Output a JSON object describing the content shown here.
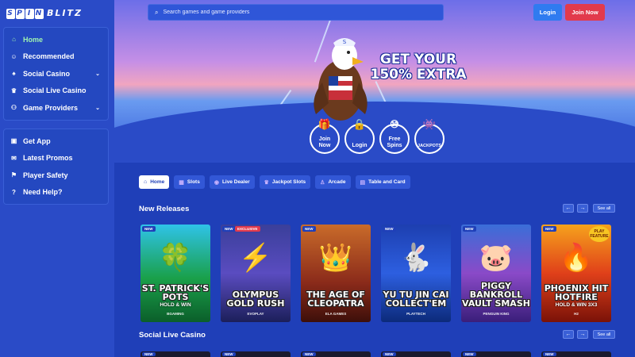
{
  "brand": {
    "logo_spin": [
      "S",
      "P",
      "I",
      "N"
    ],
    "logo_blitz": "BLITZ"
  },
  "sidebar": {
    "group1": [
      {
        "label": "Home",
        "icon": "home-icon",
        "glyph": "⌂"
      },
      {
        "label": "Recommended",
        "icon": "smile-icon",
        "glyph": "☺"
      },
      {
        "label": "Social Casino",
        "icon": "spade-icon",
        "glyph": "♠"
      },
      {
        "label": "Social Live Casino",
        "icon": "crown-icon",
        "glyph": "♛"
      },
      {
        "label": "Game Providers",
        "icon": "person-icon",
        "glyph": "⚇"
      }
    ],
    "group2": [
      {
        "label": "Get App",
        "icon": "app-icon",
        "glyph": "▣"
      },
      {
        "label": "Latest Promos",
        "icon": "gift-icon",
        "glyph": "✉"
      },
      {
        "label": "Player Safety",
        "icon": "shield-icon",
        "glyph": "⚑"
      },
      {
        "label": "Need Help?",
        "icon": "help-icon",
        "glyph": "?"
      }
    ],
    "chevron": "⌄"
  },
  "search": {
    "placeholder": "Search games and game providers"
  },
  "header": {
    "login_label": "Login",
    "join_label": "Join Now"
  },
  "hero": {
    "line1": "GET YOUR",
    "line2": "150% EXTRA",
    "buttons": [
      {
        "l1": "Join",
        "l2": "Now",
        "glyph": "🎁"
      },
      {
        "l1": "Login",
        "l2": "",
        "glyph": "🔒"
      },
      {
        "l1": "Free",
        "l2": "Spins",
        "glyph": "⑩"
      },
      {
        "l1": "JACKPOTS",
        "l2": "",
        "glyph": "👾"
      }
    ]
  },
  "tabs": [
    {
      "label": "Home",
      "glyph": "⌂"
    },
    {
      "label": "Slots",
      "glyph": "▦"
    },
    {
      "label": "Live Dealer",
      "glyph": "◉"
    },
    {
      "label": "Jackpot Slots",
      "glyph": "♛"
    },
    {
      "label": "Arcade",
      "glyph": "♙"
    },
    {
      "label": "Table and Card",
      "glyph": "▤"
    }
  ],
  "sections": {
    "new_releases": "New Releases",
    "social_live": "Social Live Casino",
    "see_all": "See all",
    "prev": "←",
    "next": "→"
  },
  "games": [
    {
      "title": "ST. PATRICK'S POTS",
      "sub": "HOLD & WIN",
      "provider": "BGAMING",
      "new": "NEW",
      "exclusive": "",
      "art": "🍀",
      "bg": "linear-gradient(180deg,#2fc3e8 0%,#1aa04a 55%,#0b5e2a 100%)"
    },
    {
      "title": "OLYMPUS GOLD RUSH",
      "sub": "",
      "provider": "EVOPLAY",
      "new": "NEW",
      "exclusive": "EXCLUSIVE",
      "art": "⚡",
      "bg": "linear-gradient(180deg,#3a3f9a 0%,#5a4cc0 50%,#1c1f5a 100%)"
    },
    {
      "title": "THE AGE OF CLEOPATRA",
      "sub": "",
      "provider": "ELA GAMES",
      "new": "NEW",
      "exclusive": "",
      "art": "👑",
      "bg": "linear-gradient(180deg,#c96b2a 0%,#8a2a1a 60%,#3d0f0a 100%)"
    },
    {
      "title": "YU TU JIN CAI COLLECT'EM",
      "sub": "",
      "provider": "PLAYTECH",
      "new": "NEW",
      "exclusive": "",
      "art": "🐇",
      "bg": "linear-gradient(180deg,#1d3fb0 0%,#2d5fe0 50%,#0c2a7a 100%)"
    },
    {
      "title": "PIGGY BANKROLL VAULT SMASH",
      "sub": "",
      "provider": "PENGUIN KING",
      "new": "NEW",
      "exclusive": "",
      "art": "🐷",
      "bg": "linear-gradient(180deg,#3a6ed8 0%,#8a4ac8 50%,#3a1e7a 100%)"
    },
    {
      "title": "PHOENIX HIT HOTFIRE",
      "sub": "HOLD & WIN 3X3",
      "provider": "H2",
      "new": "NEW",
      "exclusive": "",
      "art": "🔥",
      "bg": "linear-gradient(180deg,#f6a21c 0%,#e0401a 50%,#7a1208 100%)",
      "badge": "PLAY FEATURE"
    }
  ],
  "live_new": "NEW"
}
